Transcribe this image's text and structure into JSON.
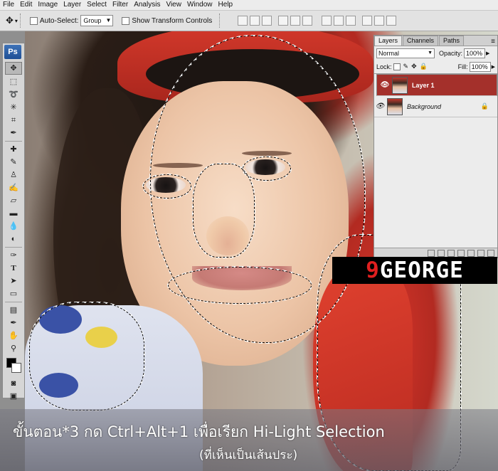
{
  "app": {
    "name": "Photoshop",
    "logo": "Ps"
  },
  "menubar": {
    "items": [
      "File",
      "Edit",
      "Image",
      "Layer",
      "Select",
      "Filter",
      "Analysis",
      "View",
      "Window",
      "Help"
    ]
  },
  "options_bar": {
    "auto_select_label": "Auto-Select:",
    "auto_select_value": "Group",
    "show_transform_label": "Show Transform Controls"
  },
  "tools": [
    "move-tool",
    "marquee-tool",
    "lasso-tool",
    "magic-wand-tool",
    "crop-tool",
    "eyedropper-tool",
    "healing-brush-tool",
    "brush-tool",
    "clone-stamp-tool",
    "history-brush-tool",
    "eraser-tool",
    "gradient-tool",
    "blur-tool",
    "dodge-tool",
    "pen-tool",
    "type-tool",
    "path-selection-tool",
    "shape-tool",
    "notes-tool",
    "eyedropper-2-tool",
    "hand-tool",
    "zoom-tool"
  ],
  "colors": {
    "foreground": "#000000",
    "background": "#ffffff",
    "selected_layer": "#a4302b",
    "watermark_accent": "#e01f1f"
  },
  "layers_panel": {
    "tabs": [
      "Layers",
      "Channels",
      "Paths"
    ],
    "active_tab": "Layers",
    "blend_mode": "Normal",
    "opacity_label": "Opacity:",
    "opacity_value": "100%",
    "lock_label": "Lock:",
    "fill_label": "Fill:",
    "fill_value": "100%",
    "layers": [
      {
        "name": "Layer 1",
        "selected": true,
        "visible": true
      },
      {
        "name": "Background",
        "selected": false,
        "visible": true,
        "locked": true
      }
    ]
  },
  "watermark": {
    "prefix": "9",
    "text": "GEORGE"
  },
  "caption": {
    "line1": "ขั้นตอน*3 กด Ctrl+Alt+1 เพื่อเรียก Hi-Light Selection",
    "line2": "(ที่เห็นเป็นเส้นประ)"
  }
}
